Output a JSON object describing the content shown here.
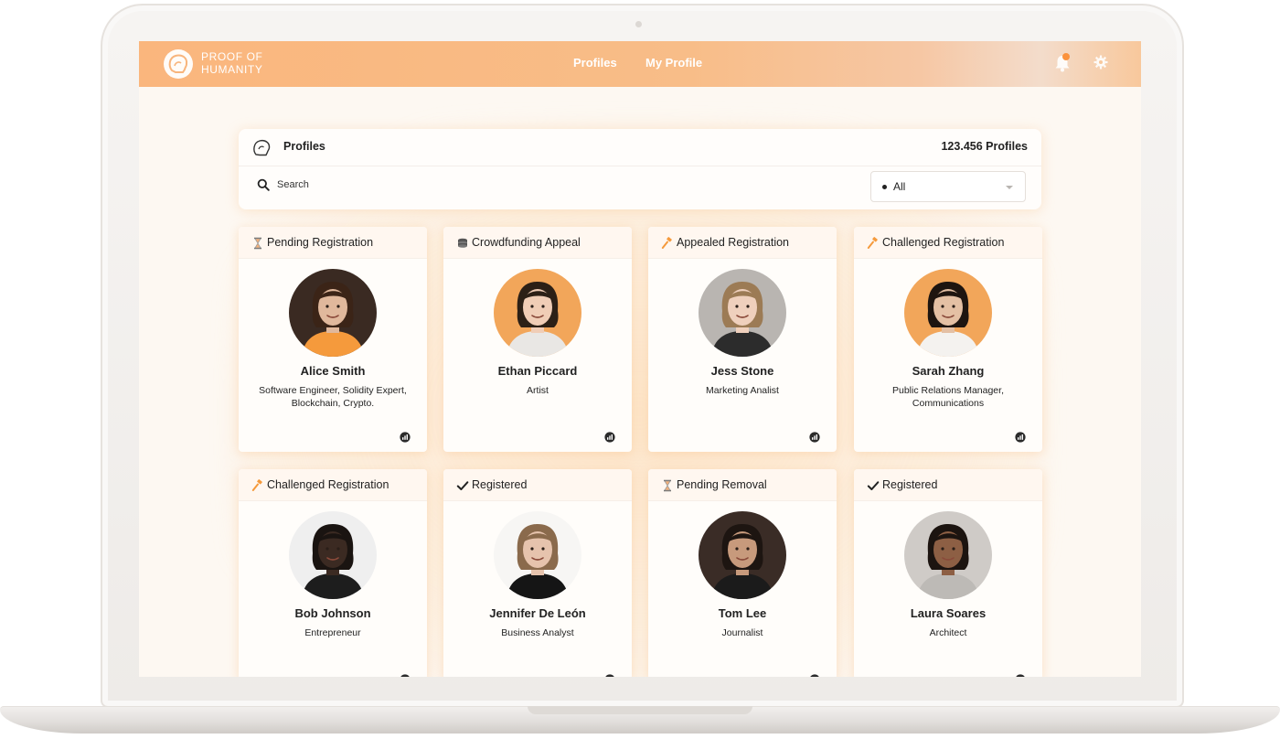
{
  "app": {
    "logo_line1": "PROOF OF",
    "logo_line2": "HUMANITY",
    "accent_color": "#fab67d",
    "background_color": "#fdf8f2"
  },
  "nav": {
    "profiles": "Profiles",
    "my_profile": "My Profile"
  },
  "topbar_icons": [
    "bell-icon",
    "gear-icon"
  ],
  "panel": {
    "title": "Profiles",
    "count": "123.456 Profiles",
    "search_placeholder": "Search",
    "filter_value": "All"
  },
  "cards": [
    {
      "status": "Pending Registration",
      "status_icon": "hourglass-icon",
      "name": "Alice Smith",
      "role": "Software Engineer, Solidity Expert, Blockchain, Crypto.",
      "avatar_bg": "#3a2a22",
      "skin": "#e0b89c",
      "hair": "#3b2417",
      "shirt": "#f59a3c"
    },
    {
      "status": "Crowdfunding Appeal",
      "status_icon": "coins-icon",
      "name": "Ethan Piccard",
      "role": "Artist",
      "avatar_bg": "#f2a65a",
      "skin": "#f0cdb6",
      "hair": "#2c2016",
      "shirt": "#e9e7e4"
    },
    {
      "status": "Appealed Registration",
      "status_icon": "gavel-icon",
      "name": "Jess Stone",
      "role": "Marketing Analist",
      "avatar_bg": "#b9b5b1",
      "skin": "#efd0bd",
      "hair": "#9c7b55",
      "shirt": "#2c2c2c"
    },
    {
      "status": "Challenged Registration",
      "status_icon": "gavel-icon",
      "name": "Sarah Zhang",
      "role": "Public Relations Manager, Communications",
      "avatar_bg": "#f2a65a",
      "skin": "#e4c0a4",
      "hair": "#1e1510",
      "shirt": "#f4f2ef"
    },
    {
      "status": "Challenged Registration",
      "status_icon": "gavel-icon",
      "name": "Bob  Johnson",
      "role": "Entrepreneur",
      "avatar_bg": "#efefef",
      "skin": "#3b2a22",
      "hair": "#1a1411",
      "shirt": "#1d1d1d"
    },
    {
      "status": "Registered",
      "status_icon": "check-icon",
      "name": "Jennifer De León",
      "role": "Business Analyst",
      "avatar_bg": "#f7f6f4",
      "skin": "#e6c3ad",
      "hair": "#8a6a4c",
      "shirt": "#151515"
    },
    {
      "status": "Pending Removal",
      "status_icon": "hourglass-icon",
      "name": "Tom Lee",
      "role": "Journalist",
      "avatar_bg": "#3a2c26",
      "skin": "#c79a7c",
      "hair": "#1d1511",
      "shirt": "#1b1b1b"
    },
    {
      "status": "Registered",
      "status_icon": "check-icon",
      "name": "Laura Soares",
      "role": "Architect",
      "avatar_bg": "#cfcbc7",
      "skin": "#8d5f44",
      "hair": "#1c1410",
      "shirt": "#bdbab6"
    }
  ]
}
